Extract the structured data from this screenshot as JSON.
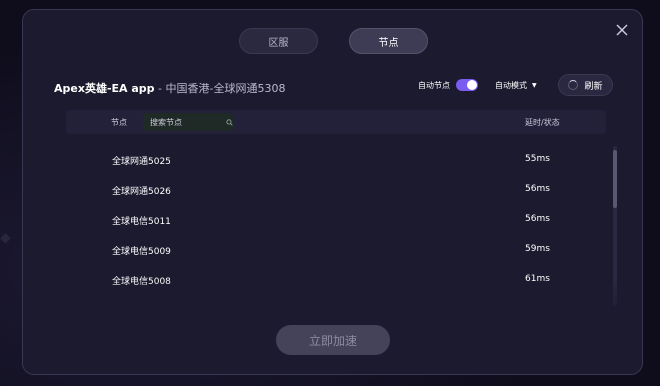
{
  "tabs": [
    {
      "label": "区服",
      "active": false
    },
    {
      "label": "节点",
      "active": true
    }
  ],
  "header": {
    "game": "Apex英雄-EA app",
    "separator": " - ",
    "node_path": "中国香港-全球网通5308"
  },
  "controls": {
    "auto_node_label": "自动节点",
    "auto_node_on": true,
    "mode_label": "自动模式",
    "refresh_label": "刷新"
  },
  "table": {
    "col_node": "节点",
    "search_placeholder": "搜索节点",
    "col_latency": "延时/状态",
    "rows": [
      {
        "name": "全球网通5025",
        "latency": "55ms"
      },
      {
        "name": "全球网通5026",
        "latency": "56ms"
      },
      {
        "name": "全球电信5011",
        "latency": "56ms"
      },
      {
        "name": "全球电信5009",
        "latency": "59ms"
      },
      {
        "name": "全球电信5008",
        "latency": "61ms"
      }
    ]
  },
  "accelerate_label": "立即加速",
  "colors": {
    "accent": "#7b5cf0",
    "panel": "#1c1a2f",
    "button_disabled": "#45435a"
  }
}
